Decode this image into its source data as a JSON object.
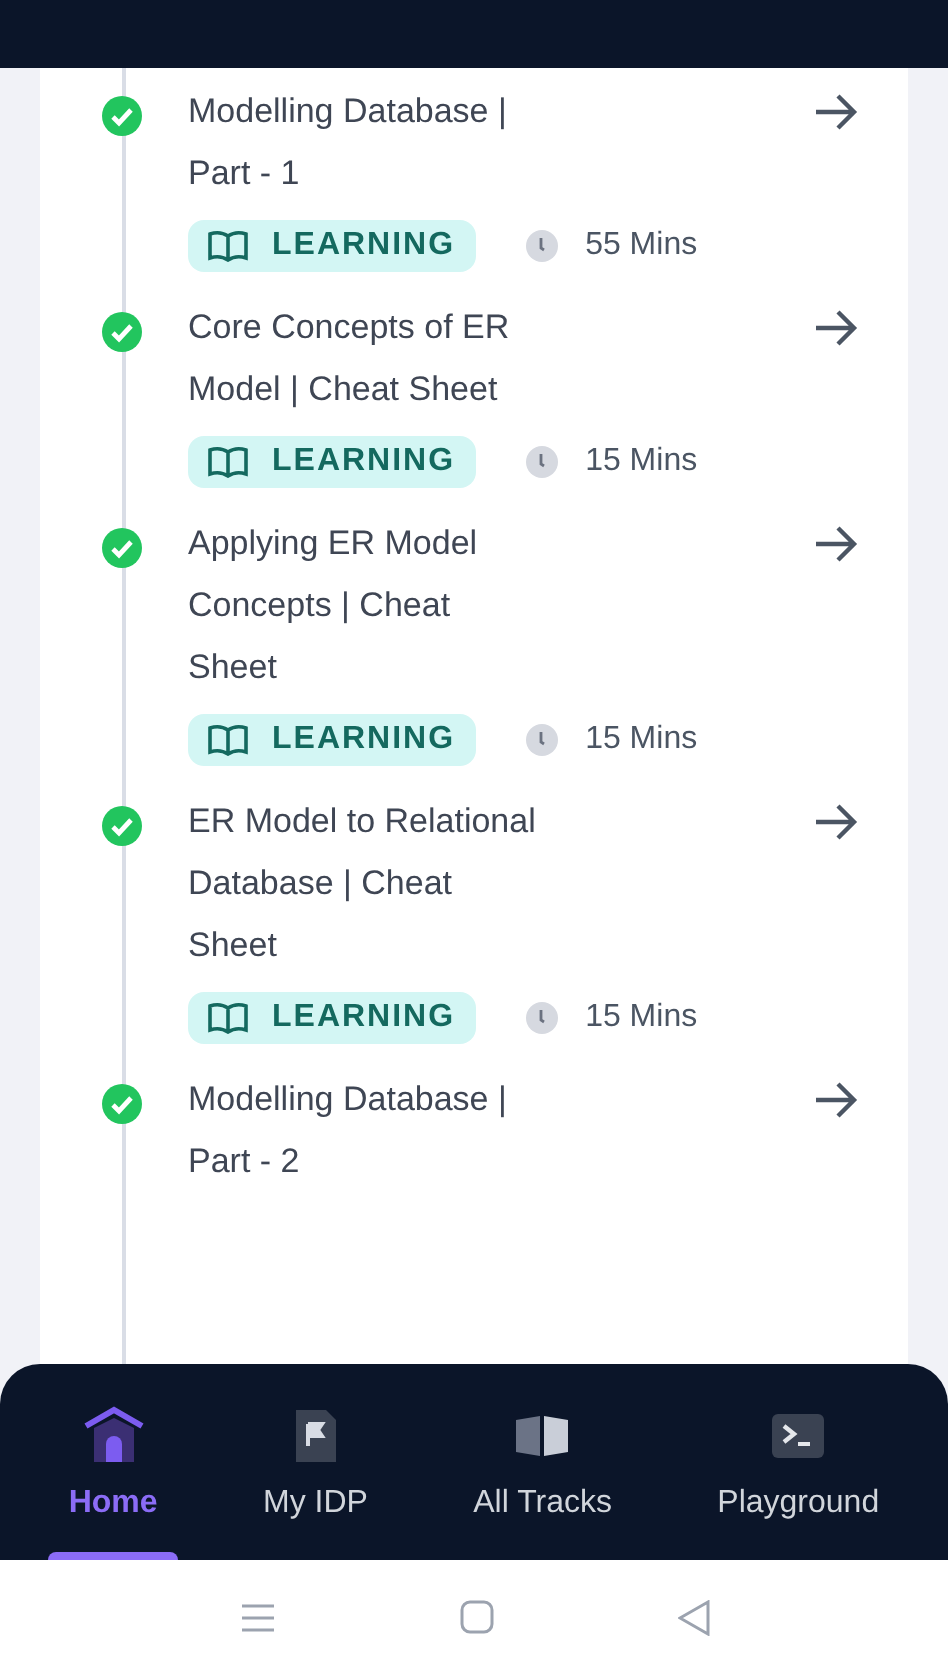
{
  "lessons": [
    {
      "title": "Modelling Database | Part - 1",
      "completed": true,
      "tag": "LEARNING",
      "duration": "55 Mins"
    },
    {
      "title": "Core Concepts of ER Model | Cheat Sheet",
      "completed": true,
      "tag": "LEARNING",
      "duration": "15 Mins"
    },
    {
      "title": "Applying ER Model Concepts | Cheat Sheet",
      "completed": true,
      "tag": "LEARNING",
      "duration": "15 Mins"
    },
    {
      "title": "ER Model to Relational Database | Cheat Sheet",
      "completed": true,
      "tag": "LEARNING",
      "duration": "15 Mins"
    },
    {
      "title": "Modelling Database | Part - 2",
      "completed": true
    }
  ],
  "nav": [
    {
      "label": "Home",
      "kind": "home",
      "selected": true
    },
    {
      "label": "My IDP",
      "kind": "idp",
      "selected": false
    },
    {
      "label": "All Tracks",
      "kind": "tracks",
      "selected": false
    },
    {
      "label": "Playground",
      "kind": "playground",
      "selected": false
    }
  ]
}
